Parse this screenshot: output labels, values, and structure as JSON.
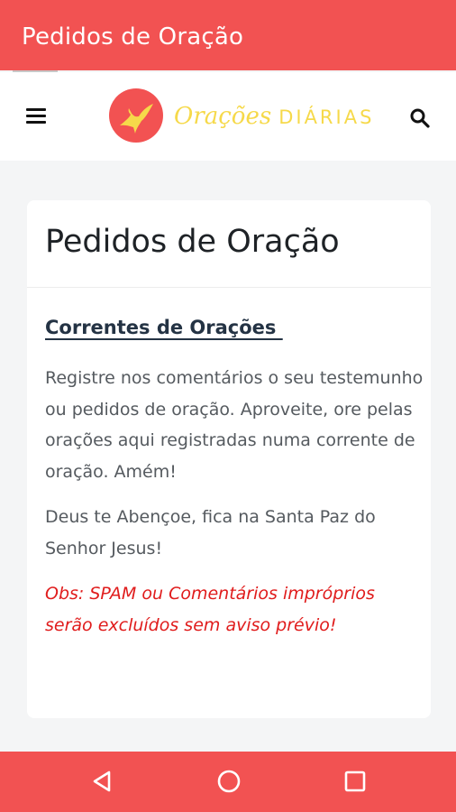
{
  "app_bar": {
    "title": "Pedidos de Oração"
  },
  "site_header": {
    "menu_icon": "hamburger-menu-icon",
    "logo": {
      "icon": "dove-icon",
      "script_text": "Orações",
      "caps_text": "DIÁRIAS"
    },
    "search_icon": "search-icon"
  },
  "card": {
    "title": "Pedidos de Oração",
    "section_heading": "Correntes de Orações ",
    "paragraphs": [
      "Registre nos comentários o seu testemunho ou pedidos de oração. Aproveite, ore pelas orações aqui registradas numa corrente de oração. Amém!",
      "Deus te Abençoe, fica na Santa Paz do Senhor Jesus!"
    ],
    "obs": "Obs: SPAM ou Comentários impróprios serão excluídos sem aviso prévio!"
  },
  "nav_bar": {
    "back_icon": "back-triangle-icon",
    "home_icon": "home-circle-icon",
    "recents_icon": "recents-square-icon"
  },
  "colors": {
    "accent": "#f25252",
    "logo_text": "#f6d94a",
    "obs_text": "#e01c1c",
    "heading": "#243344"
  }
}
